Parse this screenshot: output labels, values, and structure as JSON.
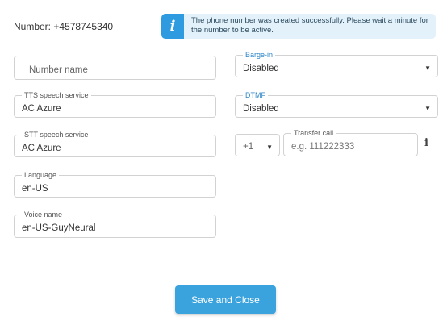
{
  "header": {
    "number_label": "Number: +4578745340",
    "banner_message": "The phone number was created successfully. Please wait a minute for the number to be active.",
    "banner_icon": "info-icon"
  },
  "form": {
    "number_name": {
      "placeholder": "Number name",
      "value": ""
    },
    "tts_service": {
      "label": "TTS speech service",
      "value": "AC Azure"
    },
    "stt_service": {
      "label": "STT speech service",
      "value": "AC Azure"
    },
    "language": {
      "label": "Language",
      "value": "en-US"
    },
    "voice_name": {
      "label": "Voice name",
      "value": "en-US-GuyNeural"
    },
    "barge_in": {
      "label": "Barge-in",
      "value": "Disabled"
    },
    "dtmf": {
      "label": "DTMF",
      "value": "Disabled"
    },
    "transfer_call": {
      "country_code": "+1",
      "label": "Transfer call",
      "placeholder": "e.g. 111222333"
    },
    "help_icon": "i"
  },
  "actions": {
    "save_label": "Save and Close"
  },
  "colors": {
    "accent": "#3aa3dd",
    "banner_bg": "#e3f1fa",
    "label_blue": "#2e86c8"
  }
}
